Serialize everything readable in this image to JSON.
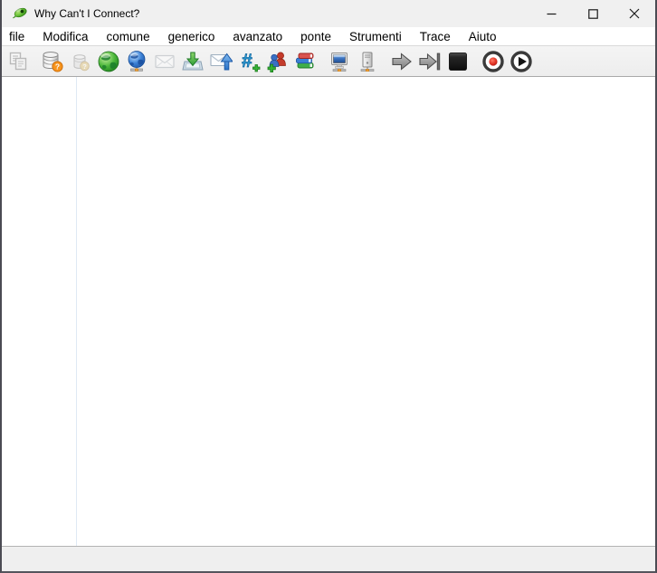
{
  "window": {
    "title": "Why Can't I Connect?"
  },
  "menubar": {
    "items": [
      "file",
      "Modifica",
      "comune",
      "generico",
      "avanzato",
      "ponte",
      "Strumenti",
      "Trace",
      "Aiuto"
    ]
  },
  "toolbar": {
    "icons": [
      {
        "name": "copy-icon",
        "enabled": false
      },
      {
        "name": "database-question-icon",
        "enabled": true
      },
      {
        "name": "database-question-small-icon",
        "enabled": false
      },
      {
        "name": "green-globe-icon",
        "enabled": true
      },
      {
        "name": "blue-globe-network-icon",
        "enabled": true
      },
      {
        "name": "envelope-icon",
        "enabled": false
      },
      {
        "name": "inbox-download-icon",
        "enabled": true
      },
      {
        "name": "envelope-upload-icon",
        "enabled": true
      },
      {
        "name": "irc-channel-add-icon",
        "enabled": true
      },
      {
        "name": "users-add-icon",
        "enabled": true
      },
      {
        "name": "books-icon",
        "enabled": true
      },
      {
        "name": "client-computer-icon",
        "enabled": true
      },
      {
        "name": "server-computer-icon",
        "enabled": true
      },
      {
        "name": "step-arrow-icon",
        "enabled": true
      },
      {
        "name": "step-to-end-icon",
        "enabled": true
      },
      {
        "name": "stop-icon",
        "enabled": true
      },
      {
        "name": "record-icon",
        "enabled": true
      },
      {
        "name": "play-icon",
        "enabled": true
      }
    ]
  },
  "statusbar": {
    "text": ""
  },
  "colors": {
    "titlebar_bg": "#f0f0f0",
    "toolbar_bg": "#f0f0f0",
    "statusbar_bg": "#efefef",
    "window_border": "#4b4b53",
    "pane_divider": "#dfe9f4",
    "logo_green": "#5cb82e",
    "record_red": "#d92b20",
    "globe_green": "#2fa335",
    "globe_blue": "#2f6fc4"
  }
}
